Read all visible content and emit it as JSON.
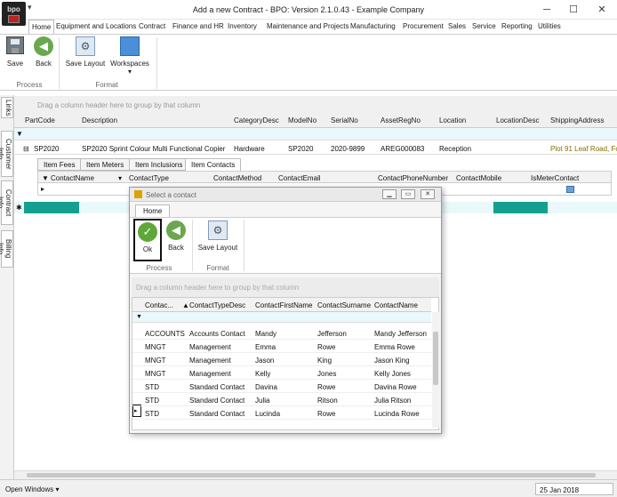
{
  "window": {
    "title": "Add a new Contract - BPO: Version 2.1.0.43 - Example Company",
    "logo_text": "bpo",
    "quick_access": "▾",
    "min": "─",
    "max": "☐",
    "close": "✕"
  },
  "menu": [
    "Home",
    "Equipment and Locations",
    "Contract",
    "Finance and HR",
    "Inventory",
    "Maintenance and Projects",
    "Manufacturing",
    "Procurement",
    "Sales",
    "Service",
    "Reporting",
    "Utilities"
  ],
  "ribbon": {
    "save": "Save",
    "back": "Back",
    "save_layout": "Save Layout",
    "workspaces": "Workspaces",
    "workspaces_arrow": "▾",
    "process_group": "Process",
    "format_group": "Format"
  },
  "side_tabs": [
    "Links",
    "Customer Info",
    "Contract Info",
    "Billing Info"
  ],
  "group_hint": "Drag a column header here to group by that column",
  "main_grid": {
    "columns": [
      "PartCode",
      "Description",
      "CategoryDesc",
      "ModelNo",
      "SerialNo",
      "AssetRegNo",
      "Location",
      "LocationDesc",
      "ShippingAddress"
    ],
    "row": {
      "expander": "⊟",
      "PartCode": "SP2020",
      "Description": "SP2020 Sprint Colour Multi Functional Copier",
      "CategoryDesc": "Hardware",
      "ModelNo": "SP2020",
      "SerialNo": "2020-9899",
      "AssetRegNo": "AREG000083",
      "Location": "Reception",
      "LocationDesc": "",
      "ShippingAddress": "Plot 91 Leaf Road, Fo"
    }
  },
  "sub_tabs": [
    "Item Fees",
    "Item Meters",
    "Item Inclusions",
    "Item Contacts"
  ],
  "sub_grid": {
    "columns": [
      "ContactName",
      "ContactType",
      "ContactMethod",
      "ContactEmail",
      "ContactPhoneNumber",
      "ContactMobile",
      "IsMeterContact"
    ]
  },
  "status": {
    "open_windows": "Open Windows ▾",
    "date": "25 Jan 2018"
  },
  "dialog": {
    "title": "Select a contact",
    "min": "▁",
    "max": "▭",
    "close": "✕",
    "tab": "Home",
    "ok": "Ok",
    "back": "Back",
    "save_layout": "Save Layout",
    "process_group": "Process",
    "format_group": "Format",
    "group_hint": "Drag a column header here to group by that column",
    "columns": [
      "Contac...",
      "ContactTypeDesc",
      "ContactFirstName",
      "ContactSurname",
      "ContactName"
    ],
    "rows": [
      [
        "ACCOUNTS",
        "Accounts Contact",
        "Mandy",
        "Jefferson",
        "Mandy Jefferson"
      ],
      [
        "MNGT",
        "Management",
        "Emma",
        "Rowe",
        "Emma Rowe"
      ],
      [
        "MNGT",
        "Management",
        "Jason",
        "King",
        "Jason King"
      ],
      [
        "MNGT",
        "Management",
        "Kelly",
        "Jones",
        "Kelly Jones"
      ],
      [
        "STD",
        "Standard Contact",
        "Davina",
        "Rowe",
        "Davina Rowe"
      ],
      [
        "STD",
        "Standard Contact",
        "Julia",
        "Ritson",
        "Julia Ritson"
      ],
      [
        "STD",
        "Standard Contact",
        "Lucinda",
        "Rowe",
        "Lucinda Rowe"
      ]
    ]
  },
  "colors": {
    "accent_green": "#6aa84f",
    "teal": "#14a08e",
    "filter_row": "#eaf8fb",
    "shipping_text": "#8a6d00"
  }
}
